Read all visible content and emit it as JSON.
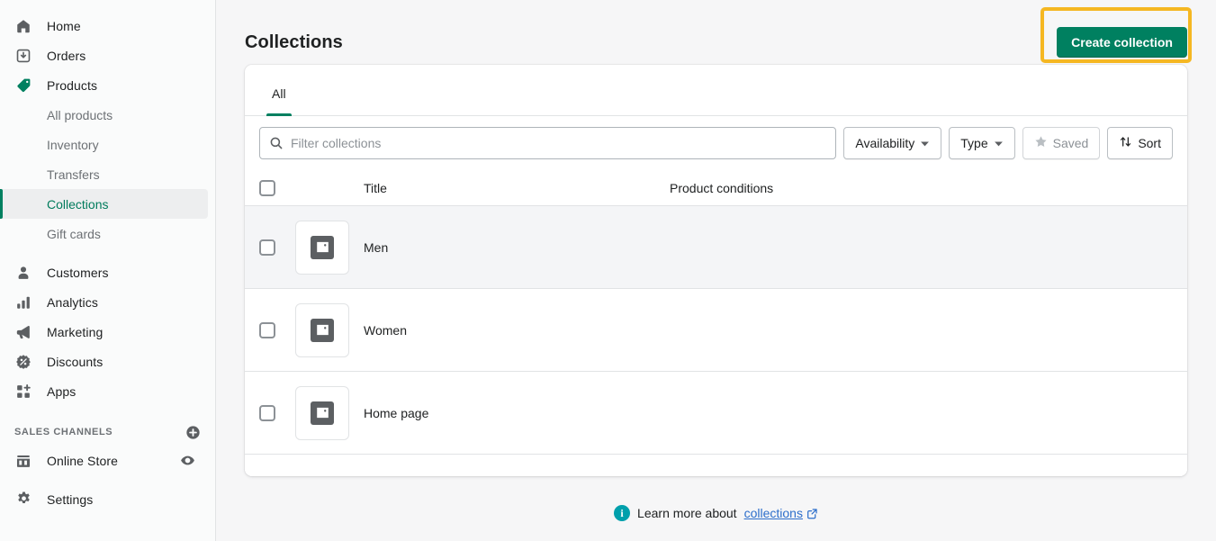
{
  "sidebar": {
    "items": [
      {
        "label": "Home",
        "icon": "home-icon",
        "type": "item"
      },
      {
        "label": "Orders",
        "icon": "orders-icon",
        "type": "item"
      },
      {
        "label": "Products",
        "icon": "products-tag-icon",
        "type": "item"
      },
      {
        "label": "All products",
        "type": "sub"
      },
      {
        "label": "Inventory",
        "type": "sub"
      },
      {
        "label": "Transfers",
        "type": "sub"
      },
      {
        "label": "Collections",
        "type": "sub",
        "active": true
      },
      {
        "label": "Gift cards",
        "type": "sub"
      },
      {
        "label": "Customers",
        "icon": "customer-icon",
        "type": "item"
      },
      {
        "label": "Analytics",
        "icon": "analytics-bar-icon",
        "type": "item"
      },
      {
        "label": "Marketing",
        "icon": "megaphone-icon",
        "type": "item"
      },
      {
        "label": "Discounts",
        "icon": "discount-icon",
        "type": "item"
      },
      {
        "label": "Apps",
        "icon": "apps-icon",
        "type": "item"
      }
    ],
    "section_label": "SALES CHANNELS",
    "add_channel_icon": "plus-circle-icon",
    "online_store": {
      "label": "Online Store",
      "icon": "storefront-icon",
      "trailing_icon": "eye-icon"
    },
    "settings": {
      "label": "Settings",
      "icon": "gear-icon"
    }
  },
  "header": {
    "title": "Collections",
    "create_button": "Create collection"
  },
  "tabs": [
    {
      "label": "All",
      "active": true
    }
  ],
  "filters": {
    "search_placeholder": "Filter collections",
    "search_value": "",
    "search_icon": "search-icon",
    "availability": "Availability",
    "type": "Type",
    "saved": "Saved",
    "saved_icon": "star-icon",
    "sort": "Sort",
    "sort_icon": "sort-arrows-icon"
  },
  "table": {
    "columns": {
      "title": "Title",
      "conditions": "Product conditions"
    },
    "rows": [
      {
        "title": "Men",
        "conditions": "",
        "thumb_icon": "image-placeholder-icon",
        "hovered": true
      },
      {
        "title": "Women",
        "conditions": "",
        "thumb_icon": "image-placeholder-icon",
        "hovered": false
      },
      {
        "title": "Home page",
        "conditions": "",
        "thumb_icon": "image-placeholder-icon",
        "hovered": false
      }
    ]
  },
  "footer": {
    "info_icon": "info-icon",
    "text": "Learn more about",
    "link": "collections",
    "external_icon": "external-link-icon"
  },
  "colors": {
    "brand_green": "#008060",
    "highlight_yellow": "#f5b722",
    "link_blue": "#2c6ecb",
    "info_teal": "#00a0ac",
    "page_bg": "#f6f6f7",
    "sidebar_bg": "#fafbfb"
  }
}
